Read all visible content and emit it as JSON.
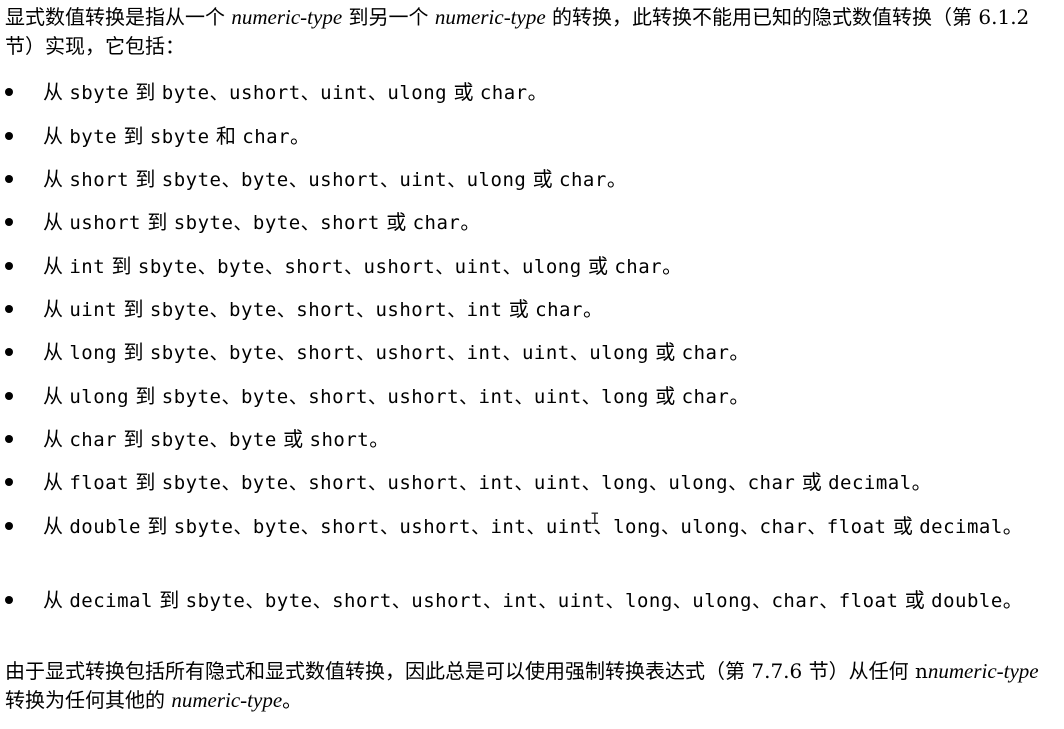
{
  "intro": {
    "part1": "显式数值转换是指从一个 ",
    "type1": "numeric-type",
    "part2": " 到另一个 ",
    "type2": "numeric-type",
    "part3": " 的转换，此转换不能用已知的隐式数值转换（第 6.1.2 节）实现，它包括："
  },
  "items": [
    {
      "from_prefix": "从 ",
      "from": "sbyte",
      "to_word": " 到 ",
      "targets": "sbyte",
      "t1": "byte、ushort、uint、ulong",
      "or_word": " 或 ",
      "last": "char",
      "end": "。"
    },
    {
      "from_prefix": "从 ",
      "from": "byte",
      "to_word": " 到 ",
      "t1": "sbyte",
      "or_word": " 和 ",
      "last": "char",
      "end": "。"
    },
    {
      "from_prefix": "从 ",
      "from": "short",
      "to_word": " 到 ",
      "t1": "sbyte、byte、ushort、uint、ulong",
      "or_word": " 或 ",
      "last": "char",
      "end": "。"
    },
    {
      "from_prefix": "从 ",
      "from": "ushort",
      "to_word": " 到 ",
      "t1": "sbyte、byte、short",
      "or_word": " 或 ",
      "last": "char",
      "end": "。"
    },
    {
      "from_prefix": "从 ",
      "from": "int",
      "to_word": " 到 ",
      "t1": "sbyte、byte、short、ushort、uint、ulong",
      "or_word": " 或 ",
      "last": "char",
      "end": "。"
    },
    {
      "from_prefix": "从 ",
      "from": "uint",
      "to_word": " 到 ",
      "t1": "sbyte、byte、short、ushort、int",
      "or_word": " 或 ",
      "last": "char",
      "end": "。"
    },
    {
      "from_prefix": "从 ",
      "from": "long",
      "to_word": " 到 ",
      "t1": "sbyte、byte、short、ushort、int、uint、ulong",
      "or_word": " 或 ",
      "last": "char",
      "end": "。"
    },
    {
      "from_prefix": "从 ",
      "from": "ulong",
      "to_word": " 到 ",
      "t1": "sbyte、byte、short、ushort、int、uint、long",
      "or_word": " 或 ",
      "last": "char",
      "end": "。"
    },
    {
      "from_prefix": "从 ",
      "from": "char",
      "to_word": " 到 ",
      "t1": "sbyte、byte",
      "or_word": " 或 ",
      "last": "short",
      "end": "。"
    },
    {
      "from_prefix": "从 ",
      "from": "float",
      "to_word": " 到 ",
      "t1": "sbyte、byte、short、ushort、int、uint、long、ulong、char",
      "or_word": " 或 ",
      "last": "decimal",
      "end": "。"
    },
    {
      "from_prefix": "从 ",
      "from": "double",
      "to_word": " 到 ",
      "t1": "sbyte、byte、short、ushort、int、uint、long、ulong、char、float",
      "or_word": " 或 ",
      "last": "decimal",
      "end": "。"
    },
    {
      "from_prefix": "从 ",
      "from": "decimal",
      "to_word": " 到 ",
      "t1": "sbyte、byte、short、ushort、int、uint、long、ulong、char、float",
      "or_word": " 或 ",
      "last": "double",
      "end": "。"
    }
  ],
  "outro": {
    "part1": "由于显式转换包括所有隐式和显式数值转换，因此总是可以使用强制转换表达式（第 7.7.6 节）从任何 n",
    "type1": "numeric-type",
    "part2": " 转换为任何其他的 ",
    "type2": "numeric-type",
    "part3": "。"
  },
  "cursor_glyph": "I"
}
